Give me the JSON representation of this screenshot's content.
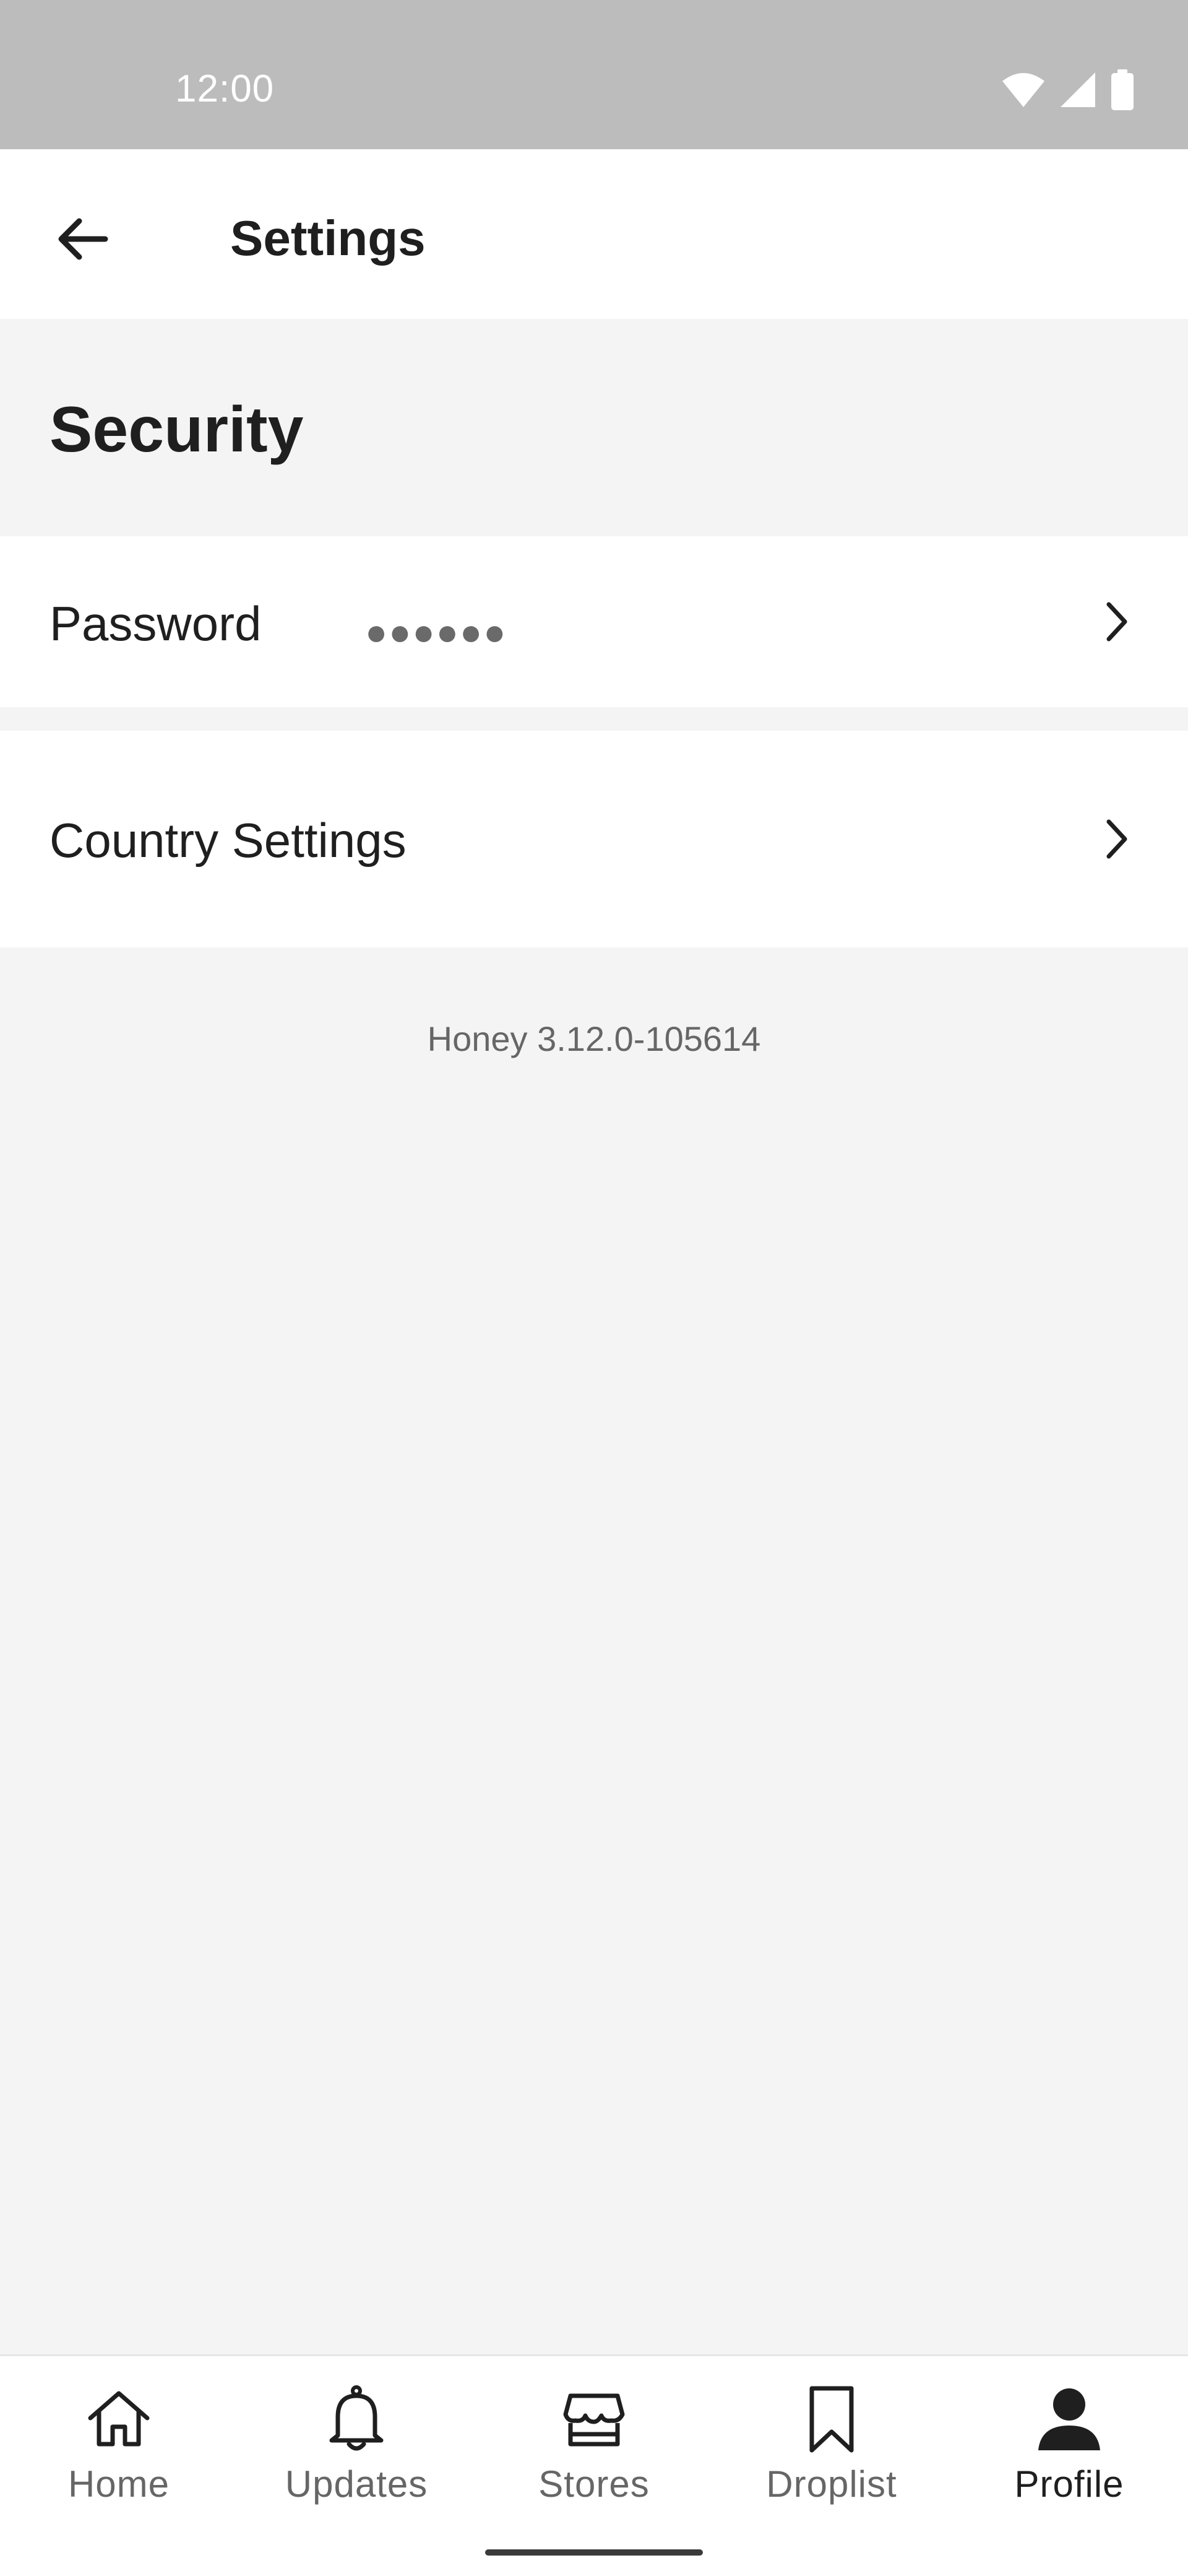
{
  "status_bar": {
    "time": "12:00",
    "icons": [
      "wifi-icon",
      "signal-icon",
      "battery-icon"
    ]
  },
  "app_bar": {
    "title": "Settings",
    "back_icon": "arrow-left-icon"
  },
  "security": {
    "section_title": "Security",
    "password_label": "Password",
    "password_value": "●●●●●●",
    "country_label": "Country Settings"
  },
  "footer": {
    "version": "Honey 3.12.0-105614"
  },
  "bottom_nav": {
    "items": [
      {
        "label": "Home",
        "icon": "home-icon"
      },
      {
        "label": "Updates",
        "icon": "bell-icon"
      },
      {
        "label": "Stores",
        "icon": "store-icon"
      },
      {
        "label": "Droplist",
        "icon": "bookmark-icon"
      },
      {
        "label": "Profile",
        "icon": "person-icon"
      }
    ],
    "active": "Profile"
  },
  "colors": {
    "status_bar_bg": "#bcbcbc",
    "page_bg": "#f4f4f4",
    "surface": "#ffffff",
    "text_primary": "#1f1f1f",
    "text_secondary": "#666666"
  }
}
